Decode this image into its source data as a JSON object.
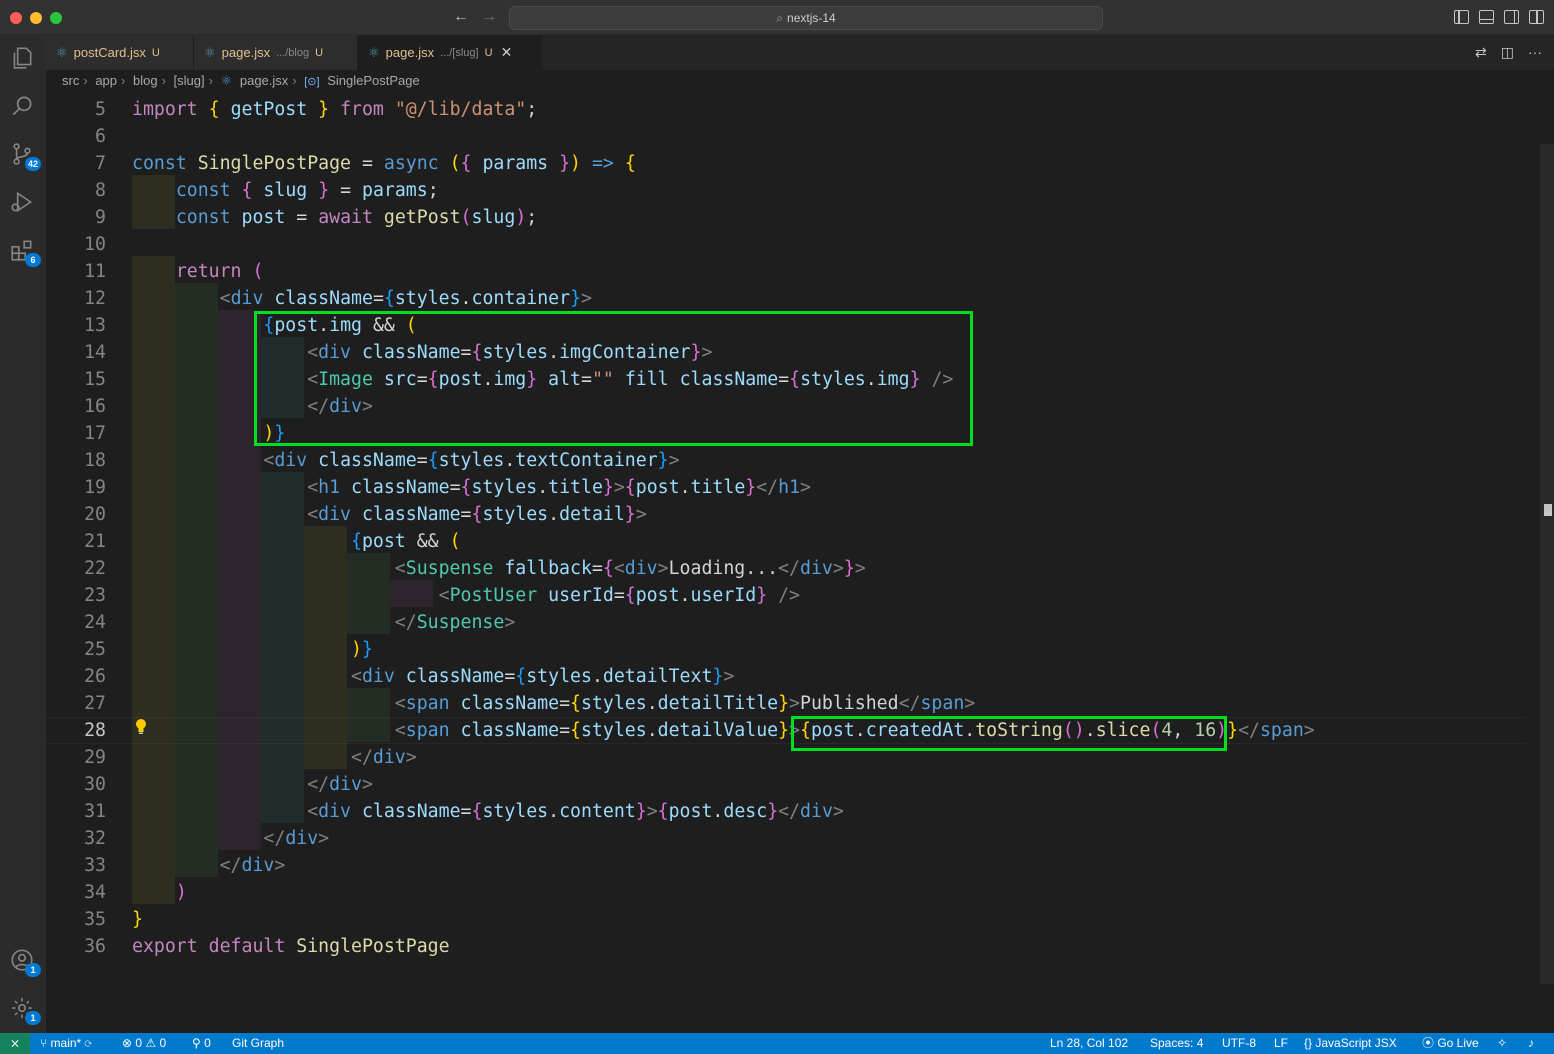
{
  "window": {
    "search_text": "nextjs-14"
  },
  "activity_bar": {
    "source_control_badge": "42",
    "extensions_badge": "6",
    "accounts_badge": "1",
    "settings_badge": "1"
  },
  "tabs": [
    {
      "label": "postCard.jsx",
      "description": "",
      "status": "U"
    },
    {
      "label": "page.jsx",
      "description": ".../blog",
      "status": "U"
    },
    {
      "label": "page.jsx",
      "description": ".../[slug]",
      "status": "U"
    }
  ],
  "breadcrumbs": [
    "src",
    "app",
    "blog",
    "[slug]",
    "page.jsx",
    "SinglePostPage"
  ],
  "editor": {
    "line_numbers": [
      "5",
      "6",
      "7",
      "8",
      "9",
      "10",
      "11",
      "12",
      "13",
      "14",
      "15",
      "16",
      "17",
      "18",
      "19",
      "20",
      "21",
      "22",
      "23",
      "24",
      "25",
      "26",
      "27",
      "28",
      "29",
      "30",
      "31",
      "32",
      "33",
      "34",
      "35",
      "36"
    ],
    "current_line": "28",
    "tokens": {
      "import": "import",
      "getPost": "getPost",
      "from": "from",
      "lib": "\"@/lib/data\"",
      "const": "const",
      "SinglePostPage": "SinglePostPage",
      "async": "async",
      "params": "params",
      "slug": "slug",
      "post": "post",
      "await": "await",
      "return": "return",
      "div": "div",
      "className": "className",
      "styles": "styles",
      "container": "container",
      "img": "img",
      "imgContainer": "imgContainer",
      "Image": "Image",
      "src": "src",
      "alt": "alt",
      "empty_str": "\"\"",
      "fill": "fill",
      "textContainer": "textContainer",
      "h1": "h1",
      "title": "title",
      "detail": "detail",
      "Suspense": "Suspense",
      "fallback": "fallback",
      "loading": "Loading...",
      "PostUser": "PostUser",
      "userId": "userId",
      "detailText": "detailText",
      "span": "span",
      "detailTitle": "detailTitle",
      "published": "Published",
      "detailValue": "detailValue",
      "createdAt": "createdAt",
      "toString": "toString",
      "slice": "slice",
      "n4": "4",
      "n16": "16",
      "content": "content",
      "desc": "desc",
      "export": "export",
      "default": "default"
    }
  },
  "statusbar": {
    "branch": "main*",
    "errors": "0",
    "warnings": "0",
    "ports": "0",
    "git_graph": "Git Graph",
    "position": "Ln 28, Col 102",
    "spaces": "Spaces: 4",
    "encoding": "UTF-8",
    "eol": "LF",
    "language": "JavaScript JSX",
    "go_live": "Go Live"
  }
}
